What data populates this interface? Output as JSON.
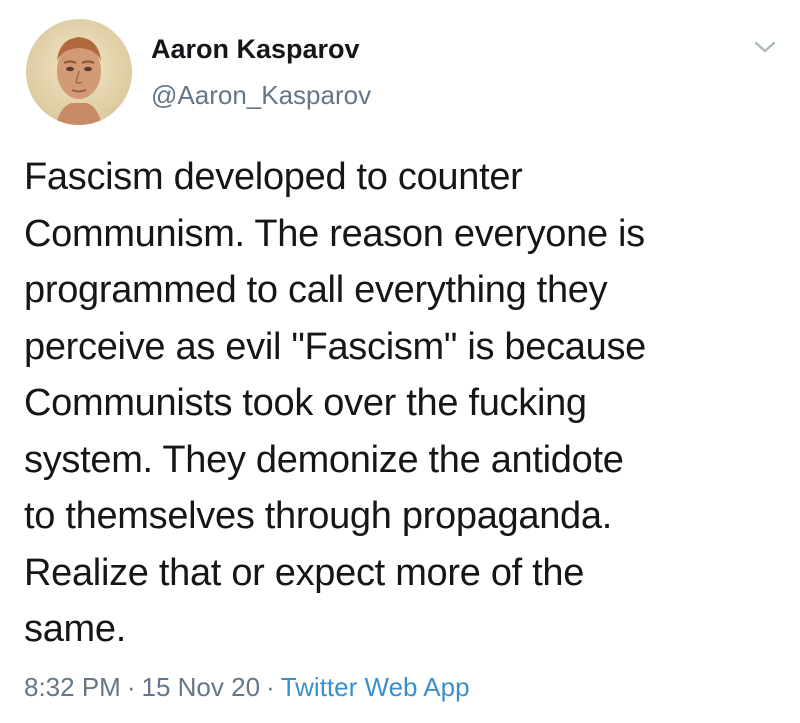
{
  "user": {
    "display_name": "Aaron Kasparov",
    "handle": "@Aaron_Kasparov",
    "avatar_icon": "profile-photo"
  },
  "tweet": {
    "text": "Fascism developed to counter\nCommunism. The reason everyone is\nprogrammed to call everything they\nperceive as evil \"Fascism\" is because\nCommunists took over the fucking\nsystem. They demonize the antidote\nto themselves through propaganda.\nRealize that or expect more of the\nsame.",
    "time": "8:32 PM",
    "separator": "·",
    "date": "15 Nov 20",
    "source": "Twitter Web App"
  },
  "icons": {
    "caret": "chevron-down-icon"
  },
  "colors": {
    "text": "#14171a",
    "secondary": "#657786",
    "link": "#3a90cc",
    "background": "#ffffff"
  }
}
